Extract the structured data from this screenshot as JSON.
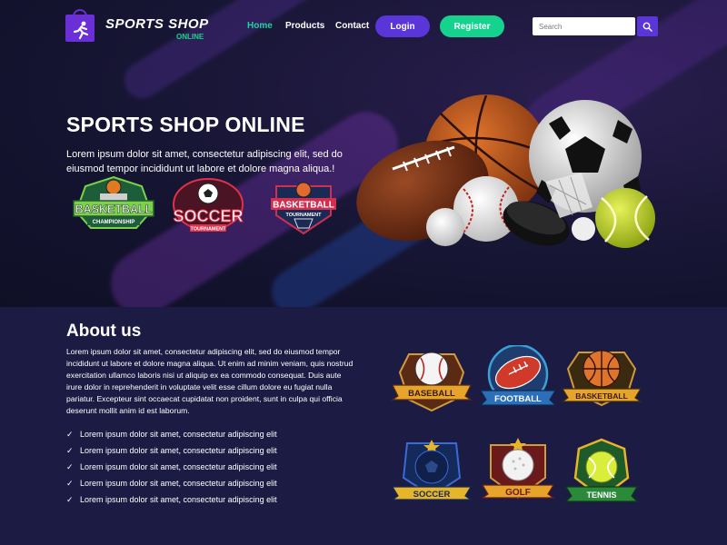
{
  "brand": {
    "title": "SPORTS SHOP",
    "subtitle": "ONLINE"
  },
  "nav": {
    "links": [
      "Home",
      "Products",
      "Contact"
    ],
    "active": "Home",
    "login": "Login",
    "register": "Register"
  },
  "search": {
    "placeholder": "Search"
  },
  "hero": {
    "title": "SPORTS SHOP ONLINE",
    "text": "Lorem ipsum dolor sit amet, consectetur adipiscing elit, sed do eiusmod tempor incididunt ut labore et dolore magna aliqua.!",
    "badges": [
      {
        "main": "BASKETBALL",
        "sub": "CHAMPIONSHIP"
      },
      {
        "main": "SOCCER",
        "sub": "TOURNAMENT"
      },
      {
        "main": "BASKETBALL",
        "sub": "TOURNAMENT"
      }
    ]
  },
  "about": {
    "title": "About us",
    "text": "Lorem ipsum dolor sit amet, consectetur adipiscing elit, sed do eiusmod tempor incididunt ut labore et dolore magna aliqua. Ut enim ad minim veniam, quis nostrud exercitation ullamco laboris nisi ut aliquip ex ea commodo consequat. Duis aute irure dolor in reprehenderit in voluptate velit esse cillum dolore eu fugiat nulla pariatur. Excepteur sint occaecat cupidatat non proident, sunt in culpa qui officia deserunt mollit anim id est laborum.",
    "list": [
      "Lorem ipsum dolor sit amet, consectetur adipiscing elit",
      "Lorem ipsum dolor sit amet, consectetur adipiscing elit",
      "Lorem ipsum dolor sit amet, consectetur adipiscing elit",
      "Lorem ipsum dolor sit amet, consectetur adipiscing elit",
      "Lorem ipsum dolor sit amet, consectetur adipiscing elit"
    ],
    "emblems": [
      "BASEBALL",
      "FOOTBALL",
      "BASKETBALL",
      "SOCCER",
      "GOLF",
      "TENNIS"
    ]
  },
  "colors": {
    "accent_purple": "#5a35d8",
    "accent_green": "#15d38e",
    "active_link": "#1fd3a0",
    "section_bg": "#1c1b44"
  }
}
